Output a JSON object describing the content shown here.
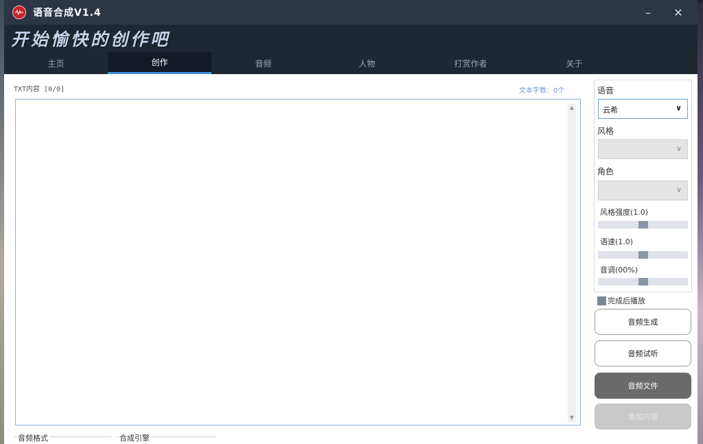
{
  "window": {
    "title": "语音合成V1.4",
    "minimize_glyph": "–",
    "close_glyph": "✕"
  },
  "banner": {
    "slogan": "开始愉快的创作吧"
  },
  "tabs": [
    {
      "label": "主页",
      "active": false
    },
    {
      "label": "创作",
      "active": true
    },
    {
      "label": "音频",
      "active": false
    },
    {
      "label": "人物",
      "active": false
    },
    {
      "label": "打赏作者",
      "active": false
    },
    {
      "label": "关于",
      "active": false
    }
  ],
  "editor": {
    "txt_label": "TXT内容 [0/0]",
    "word_count": "文本字数：0个"
  },
  "bottom": {
    "audio_format_label": "音频格式",
    "engine_label": "合成引擎"
  },
  "side": {
    "voice_label": "语音",
    "voice_value": "云希",
    "style_label": "风格",
    "style_value": "",
    "role_label": "角色",
    "role_value": "",
    "style_strength_label": "风格强度(1.0)",
    "style_strength_level": 0.5,
    "speed_label": "语速(1.0)",
    "speed_level": 0.5,
    "pitch_label": "音调(00%)",
    "pitch_level": 0.5
  },
  "play_after_done": {
    "label": "完成后播放",
    "checked": true
  },
  "buttons": {
    "generate": "音频生成",
    "preview": "音频试听",
    "file": "音频文件",
    "add_content": "添加内容"
  },
  "colors": {
    "titlebar": "#2c3645",
    "banner": "#1f2733",
    "tab_active_underline": "#4a90e2",
    "app_icon": "#c8232c"
  },
  "icons": {
    "app": "app-logo-icon",
    "dropdown": "chevron-down-icon"
  }
}
